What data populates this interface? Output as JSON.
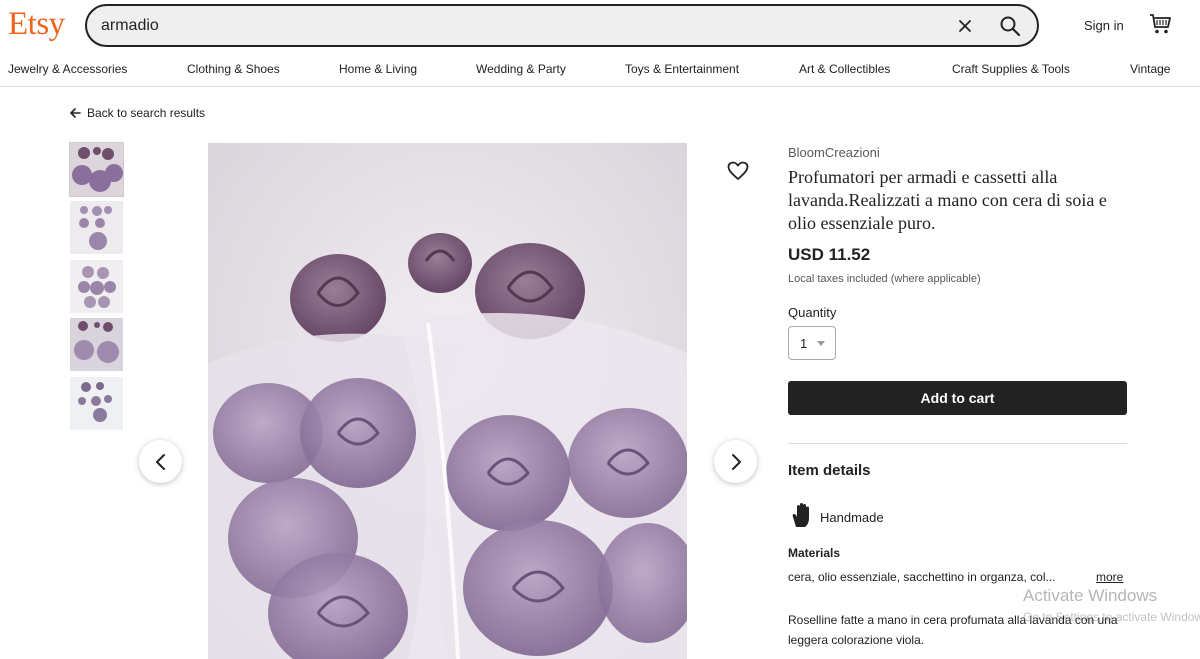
{
  "header": {
    "logo": "Etsy",
    "search_value": "armadio",
    "signin_label": "Sign in"
  },
  "categories": [
    "Jewelry & Accessories",
    "Clothing & Shoes",
    "Home & Living",
    "Wedding & Party",
    "Toys & Entertainment",
    "Art & Collectibles",
    "Craft Supplies & Tools",
    "Vintage"
  ],
  "back_label": "Back to search results",
  "listing": {
    "shop_name": "BloomCreazioni",
    "title": "Profumatori per armadi e cassetti alla lavanda.Realizzati a mano con cera di soia e olio essenziale puro.",
    "price": "USD 11.52",
    "taxes_note": "Local taxes included (where applicable)",
    "quantity_label": "Quantity",
    "quantity_value": "1",
    "add_to_cart_label": "Add to cart",
    "item_details_heading": "Item details",
    "handmade_label": "Handmade",
    "materials_heading": "Materials",
    "materials_text": "cera, olio essenziale, sacchettino in organza, col...",
    "more_label": "more",
    "description": "Roselline fatte a mano in cera profumata alla lavanda con una leggera colorazione viola."
  },
  "watermark": {
    "title": "Activate Windows",
    "subtitle": "Go to Settings to activate Windows."
  },
  "colors": {
    "brand": "#F1641E",
    "button_bg": "#222222",
    "rose": "#8a6f9c"
  }
}
